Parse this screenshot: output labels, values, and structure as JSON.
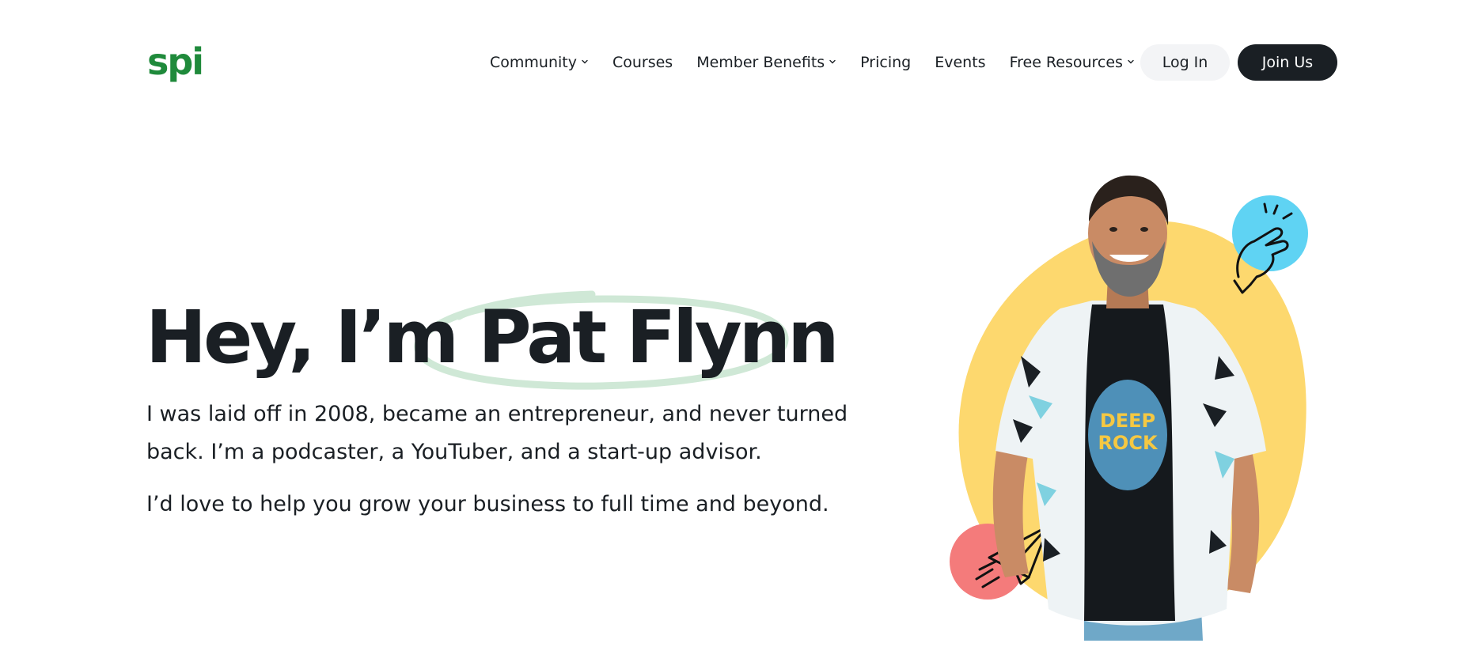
{
  "header": {
    "logo_text": "spi",
    "nav": [
      {
        "label": "Community",
        "has_dropdown": true
      },
      {
        "label": "Courses",
        "has_dropdown": false
      },
      {
        "label": "Member Benefits",
        "has_dropdown": true
      },
      {
        "label": "Pricing",
        "has_dropdown": false
      },
      {
        "label": "Events",
        "has_dropdown": false
      },
      {
        "label": "Free Resources",
        "has_dropdown": true
      }
    ],
    "login_label": "Log In",
    "join_label": "Join Us"
  },
  "hero": {
    "title": "Hey, I’m Pat Flynn",
    "paragraph_1": "I was laid off in 2008, became an entrepreneur, and never turned back. I’m a podcaster, a YouTuber, and a start-up advisor.",
    "paragraph_2": "I’d love to help you grow your business to full time and beyond."
  },
  "icons": {
    "logo": "spi-logo",
    "chevron": "chevron-down-icon",
    "snap": "finger-snap-icon",
    "plane": "paper-plane-icon"
  },
  "colors": {
    "brand_green": "#1f8a3b",
    "dark": "#1a1f24",
    "scribble_green": "#cfe8d6",
    "yellow_blob": "#fdd86e",
    "cyan_circle": "#5fd3f3",
    "coral_circle": "#f47b7b",
    "login_bg": "#f3f4f6"
  }
}
